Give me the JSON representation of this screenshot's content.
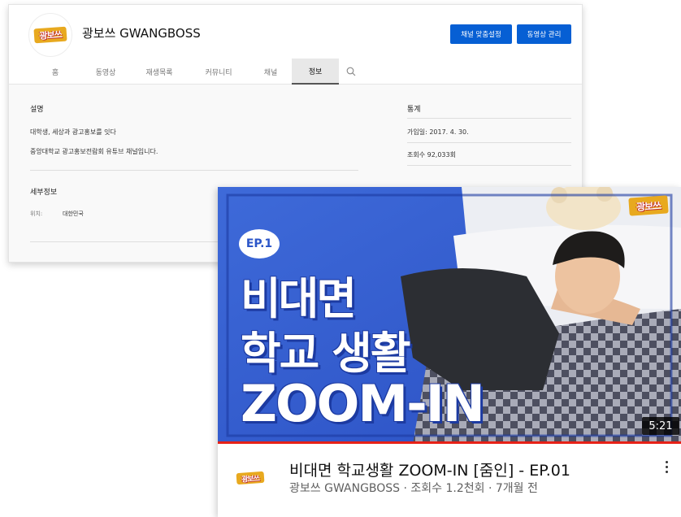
{
  "channel": {
    "avatar_text": "광보쓰",
    "name": "광보쓰 GWANGBOSS",
    "customize_label": "채널 맞춤설정",
    "manage_label": "동영상 관리",
    "brand_color": "#065fd4",
    "tabs": [
      {
        "label": "홈",
        "active": false
      },
      {
        "label": "동영상",
        "active": false
      },
      {
        "label": "재생목록",
        "active": false
      },
      {
        "label": "커뮤니티",
        "active": false
      },
      {
        "label": "채널",
        "active": false
      },
      {
        "label": "정보",
        "active": true
      }
    ],
    "search_icon": "search-icon"
  },
  "about": {
    "description_title": "설명",
    "description_lines": [
      "대학생, 세상과 광고홍보를 잇다",
      "중앙대학교 광고홍보전람회 유튜브 채널입니다."
    ],
    "details_title": "세부정보",
    "location_label": "위치:",
    "location_value": "대한민국",
    "stats_title": "통계",
    "joined": "가입일: 2017. 4. 30.",
    "views": "조회수 92,033회"
  },
  "video": {
    "thumbnail": {
      "ep_badge": "EP.1",
      "line1": "비대면",
      "line2": "학교 생활",
      "line3": "ZOOM-IN",
      "logo_text": "광보쓰",
      "accent": "#2f5fe0",
      "text_outline": "#1c3aa1"
    },
    "duration": "5:21",
    "watched_fraction": 1.0,
    "avatar_text": "광보쓰",
    "title": "비대면 학교생활 ZOOM-IN [줌인] - EP.01",
    "subtitle": "광보쓰 GWANGBOSS · 조회수 1.2천회 · 7개월 전",
    "more_icon": "more-vert-icon"
  }
}
